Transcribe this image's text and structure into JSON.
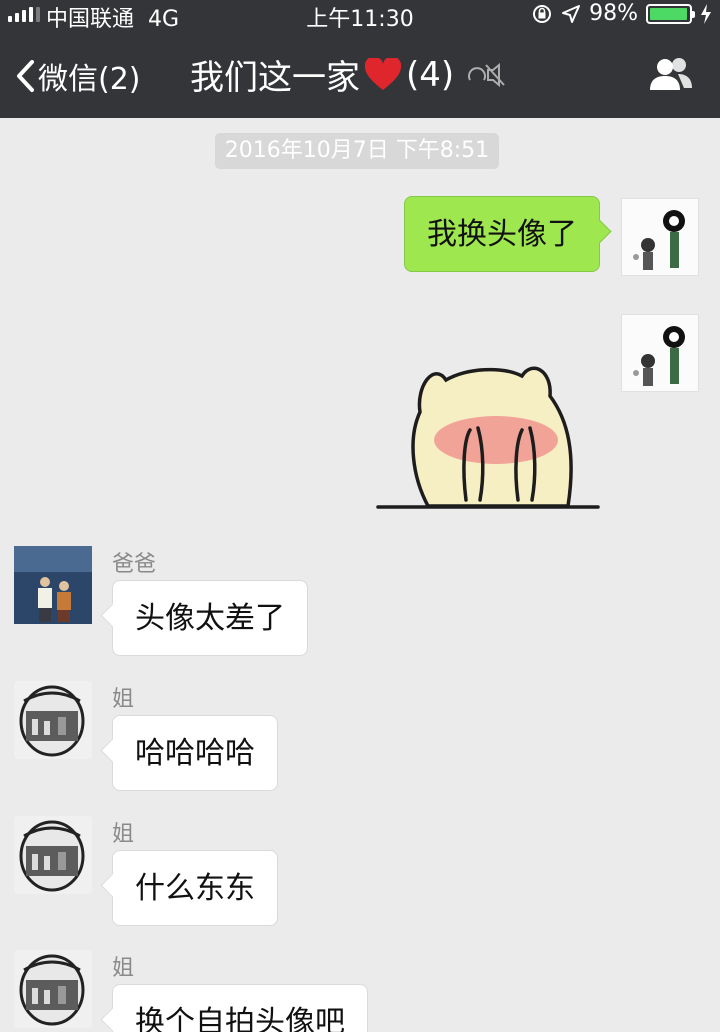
{
  "status_bar": {
    "carrier": "中国联通",
    "network": "4G",
    "time": "上午11:30",
    "battery": "98%",
    "battery_level": 0.98
  },
  "nav": {
    "back_label": "微信(2)",
    "title": "我们这一家",
    "member_count": "(4)",
    "icons": [
      "chevron-left-icon",
      "heart-icon",
      "mute-icon",
      "group-members-icon"
    ]
  },
  "chat": {
    "timestamp": "2016年10月7日 下午8:51",
    "messages": [
      {
        "side": "out",
        "type": "text",
        "text": "我换头像了"
      },
      {
        "side": "out",
        "type": "sticker",
        "sticker": "blushing-cat-covering-face"
      },
      {
        "side": "in",
        "sender": "爸爸",
        "type": "text",
        "text": "头像太差了"
      },
      {
        "side": "in",
        "sender": "姐",
        "type": "text",
        "text": "哈哈哈哈"
      },
      {
        "side": "in",
        "sender": "姐",
        "type": "text",
        "text": "什么东东"
      },
      {
        "side": "in",
        "sender": "姐",
        "type": "text",
        "text": "换个自拍头像吧"
      }
    ]
  },
  "colors": {
    "bar": "#333538",
    "chat_bg": "#ebebeb",
    "out_bubble": "#9ee74f",
    "in_bubble": "#ffffff",
    "battery": "#4cd964",
    "heart": "#e0262d"
  }
}
